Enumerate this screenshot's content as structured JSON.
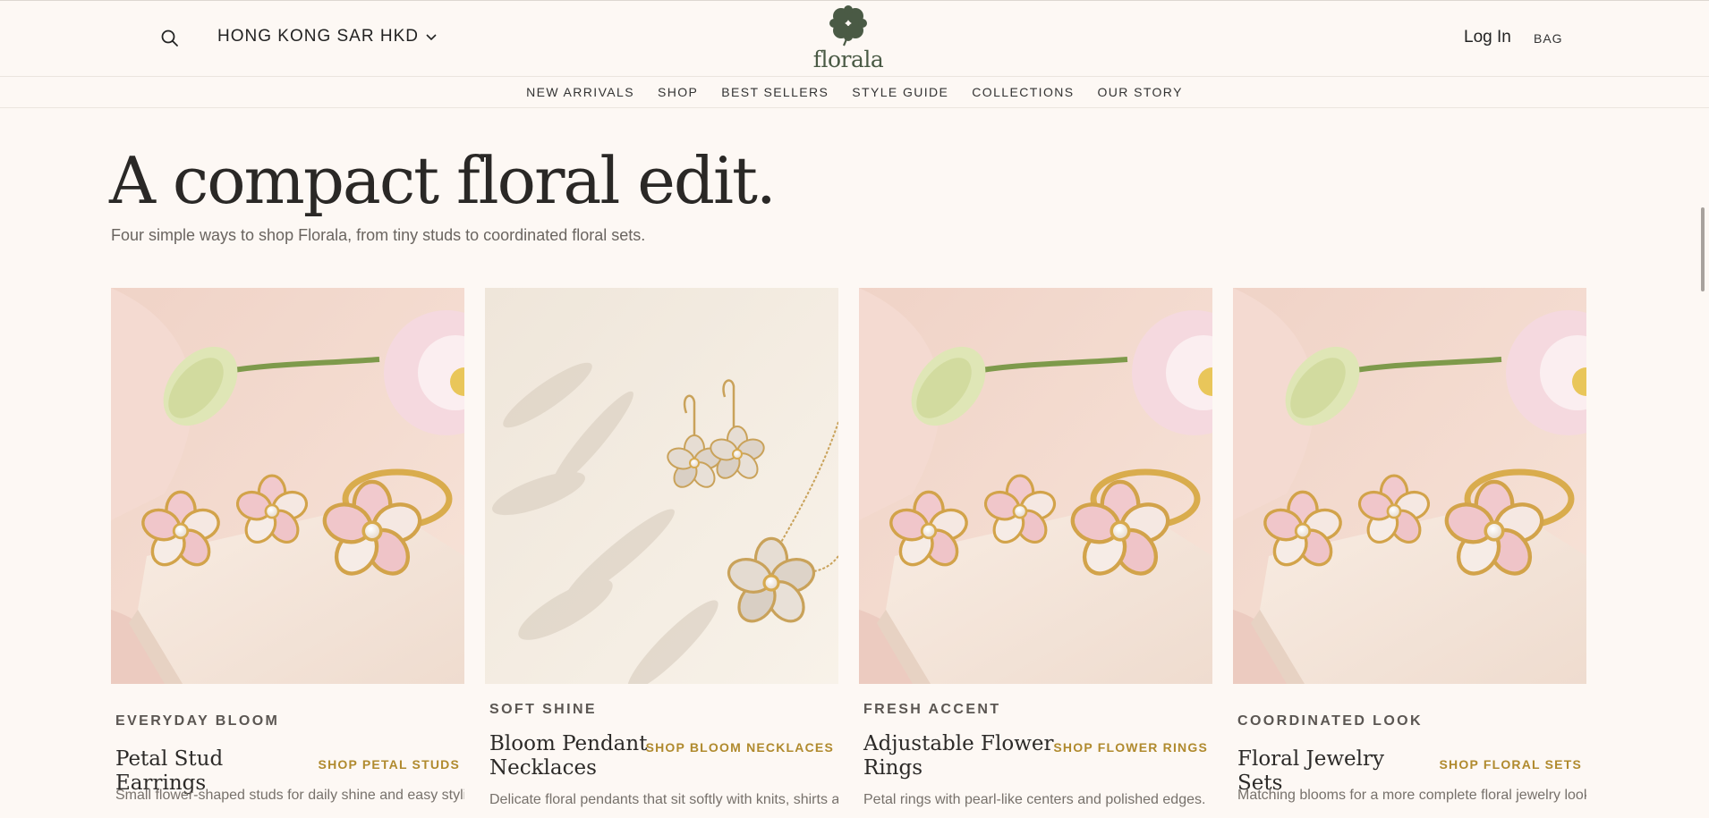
{
  "header": {
    "region_label": "HONG KONG SAR HKD",
    "logo_text": "florala",
    "login_label": "Log In",
    "bag_label": "BAG",
    "icons": {
      "search": "search-icon",
      "region": "chevron-down-icon",
      "logo": "clover-icon"
    }
  },
  "nav": {
    "items": [
      {
        "label": "NEW ARRIVALS"
      },
      {
        "label": "SHOP"
      },
      {
        "label": "BEST SELLERS"
      },
      {
        "label": "STYLE GUIDE"
      },
      {
        "label": "COLLECTIONS"
      },
      {
        "label": "OUR STORY"
      }
    ]
  },
  "hero": {
    "title": "A compact floral edit.",
    "subtitle": "Four simple ways to shop Florala, from tiny studs to coordinated floral sets."
  },
  "cards": [
    {
      "eyebrow": "EVERYDAY BLOOM",
      "title": "Petal Stud Earrings",
      "link": "SHOP PETAL STUDS",
      "description": "Small flower-shaped studs for daily shine and easy styling."
    },
    {
      "eyebrow": "SOFT SHINE",
      "title": "Bloom Pendant Necklaces",
      "link": "SHOP BLOOM NECKLACES",
      "description": "Delicate floral pendants that sit softly with knits, shirts and dresses."
    },
    {
      "eyebrow": "FRESH ACCENT",
      "title": "Adjustable Flower Rings",
      "link": "SHOP FLOWER RINGS",
      "description": "Petal rings with pearl-like centers and polished edges."
    },
    {
      "eyebrow": "COORDINATED LOOK",
      "title": "Floral Jewelry Sets",
      "link": "SHOP FLORAL SETS",
      "description": "Matching blooms for a more complete floral jewelry look."
    }
  ],
  "colors": {
    "background": "#fdf8f4",
    "accent_link": "#b08a2e",
    "logo_green": "#4a5a45"
  }
}
